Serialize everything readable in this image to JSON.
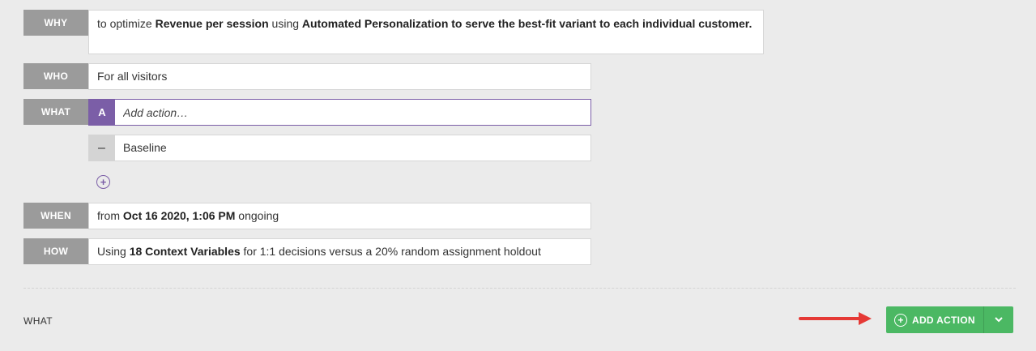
{
  "why": {
    "label": "WHY",
    "prefix": "to optimize ",
    "metric": "Revenue per session",
    "middle": " using ",
    "strategy": "Automated Personalization to serve the best-fit variant to each individual customer."
  },
  "who": {
    "label": "WHO",
    "text": "For all visitors"
  },
  "what": {
    "label": "WHAT",
    "badge": "A",
    "placeholder": "Add action…",
    "baseline_symbol": "–",
    "baseline_label": "Baseline",
    "add_variant_symbol": "+"
  },
  "when": {
    "label": "WHEN",
    "prefix": "from ",
    "date": "Oct 16 2020, 1:06 PM",
    "suffix": " ongoing"
  },
  "how": {
    "label": "HOW",
    "prefix": "Using ",
    "variables": "18 Context Variables",
    "suffix": " for 1:1 decisions versus a 20% random assignment holdout"
  },
  "footer": {
    "section_label": "WHAT",
    "add_action_label": "ADD ACTION",
    "plus_symbol": "+"
  },
  "colors": {
    "accent_purple": "#7b5ea7",
    "button_green": "#4bb863",
    "arrow_red": "#e53935",
    "label_gray": "#9b9b9b"
  }
}
